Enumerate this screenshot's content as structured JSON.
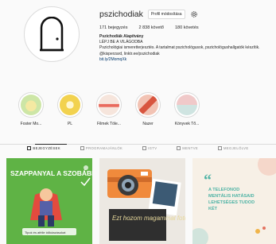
{
  "profile": {
    "username": "pszichodiak",
    "edit_button_label": "Profil módosítása",
    "stats": {
      "posts": "171 bejegyzés",
      "followers": "2 838 követő",
      "following": "180 követés"
    },
    "bio": {
      "name": "Pszichodiák Alapítvány",
      "tagline": "LÉPJ BE A VILÁGODBA",
      "description": "Pszichológiai ismeretterjesztés. A tartalmat pszichológusok, pszichológushallgatók készítik.",
      "contacts": "@kisperzard, linktr.ee/pszichodiak",
      "link": "bit.ly/2MomqXk"
    }
  },
  "highlights": [
    {
      "label": "Foster Mo..."
    },
    {
      "label": "PL"
    },
    {
      "label": "Filmek Töle..."
    },
    {
      "label": "Nazer"
    },
    {
      "label": "Könyvek Tő..."
    }
  ],
  "tabs": [
    {
      "label": "BEJEGYZÉSEK"
    },
    {
      "label": "PROGRAMAJÁNLÓK"
    },
    {
      "label": "IGTV"
    },
    {
      "label": "MENTVE"
    },
    {
      "label": "MEGJELÖLVE"
    }
  ],
  "posts": {
    "post1_text": "SZAPPANYAL A SZOBÁBLIN",
    "post1_caption": "Tipok és afélle időutazásokat",
    "post2_text": "Ezt hozom magammal fotováról...",
    "post3_text": "A TELEFONOD MENTÁLIS HATÁSAID LEHETSÉGES TUDOD KÉT"
  },
  "icons": [
    "settings-gear-icon",
    "posts-grid-icon",
    "programs-icon",
    "igtv-icon",
    "saved-icon",
    "tagged-icon"
  ]
}
